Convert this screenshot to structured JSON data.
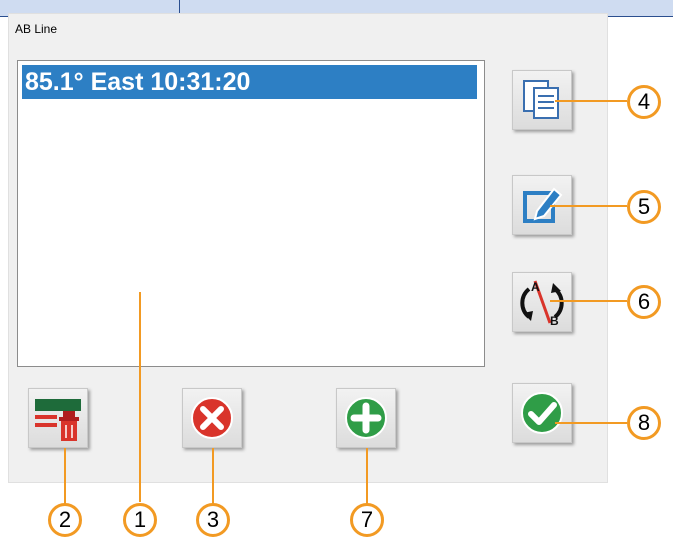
{
  "window": {
    "title": "AB Line"
  },
  "list": {
    "items": [
      "85.1° East 10:31:20"
    ]
  },
  "buttons": {
    "copy": "copy-lines-icon",
    "edit": "edit-line-icon",
    "swap": "swap-ab-direction-icon",
    "delete_all": "delete-all-lines-icon",
    "cancel": "cancel-icon",
    "add": "add-line-icon",
    "ok": "confirm-icon"
  },
  "callouts": [
    "1",
    "2",
    "3",
    "4",
    "5",
    "6",
    "7",
    "8"
  ],
  "colors": {
    "selection": "#2d7fc4",
    "callout": "#f29a23",
    "cancel": "#d9342b",
    "add": "#2f9d47",
    "ok": "#2f9d47"
  }
}
